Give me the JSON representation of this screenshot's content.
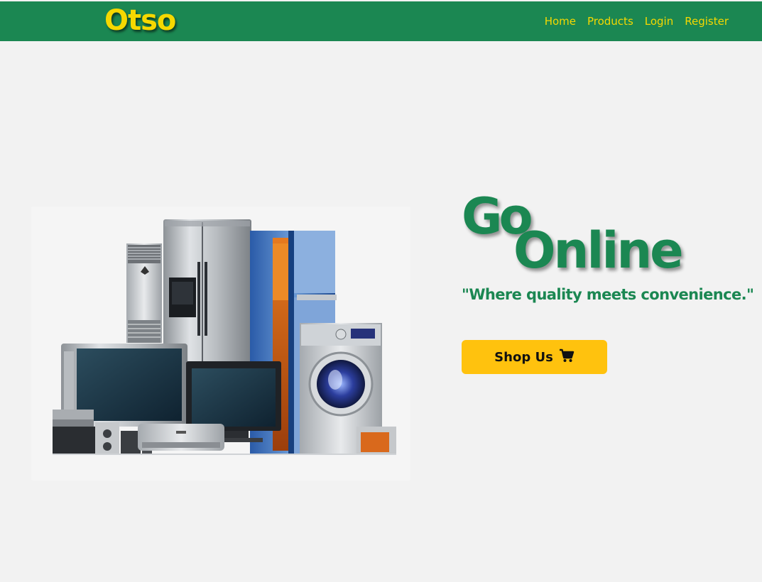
{
  "navbar": {
    "brand": "Otso",
    "links": [
      {
        "label": "Home"
      },
      {
        "label": "Products"
      },
      {
        "label": "Login"
      },
      {
        "label": "Register"
      }
    ]
  },
  "hero": {
    "headline_line1": "Go",
    "headline_line2": "Online",
    "tagline": "\"Where quality meets convenience.\"",
    "cta_label": "Shop Us",
    "cta_icon": "shopping-cart-icon",
    "image_subject": "home-appliances-image"
  },
  "colors": {
    "brand_green": "#1b8752",
    "brand_yellow": "#f5d800",
    "button_yellow": "#ffc20e",
    "page_bg": "#f2f2f2"
  }
}
